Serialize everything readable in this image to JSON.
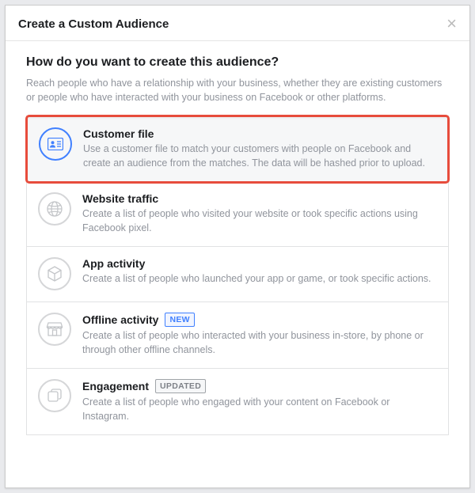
{
  "header": {
    "title": "Create a Custom Audience"
  },
  "question": "How do you want to create this audience?",
  "intro": "Reach people who have a relationship with your business, whether they are existing customers or people who have interacted with your business on Facebook or other platforms.",
  "options": {
    "customer_file": {
      "title": "Customer file",
      "desc": "Use a customer file to match your customers with people on Facebook and create an audience from the matches. The data will be hashed prior to upload."
    },
    "website_traffic": {
      "title": "Website traffic",
      "desc": "Create a list of people who visited your website or took specific actions using Facebook pixel."
    },
    "app_activity": {
      "title": "App activity",
      "desc": "Create a list of people who launched your app or game, or took specific actions."
    },
    "offline_activity": {
      "title": "Offline activity",
      "badge": "NEW",
      "desc": "Create a list of people who interacted with your business in-store, by phone or through other offline channels."
    },
    "engagement": {
      "title": "Engagement",
      "badge": "UPDATED",
      "desc": "Create a list of people who engaged with your content on Facebook or Instagram."
    }
  }
}
